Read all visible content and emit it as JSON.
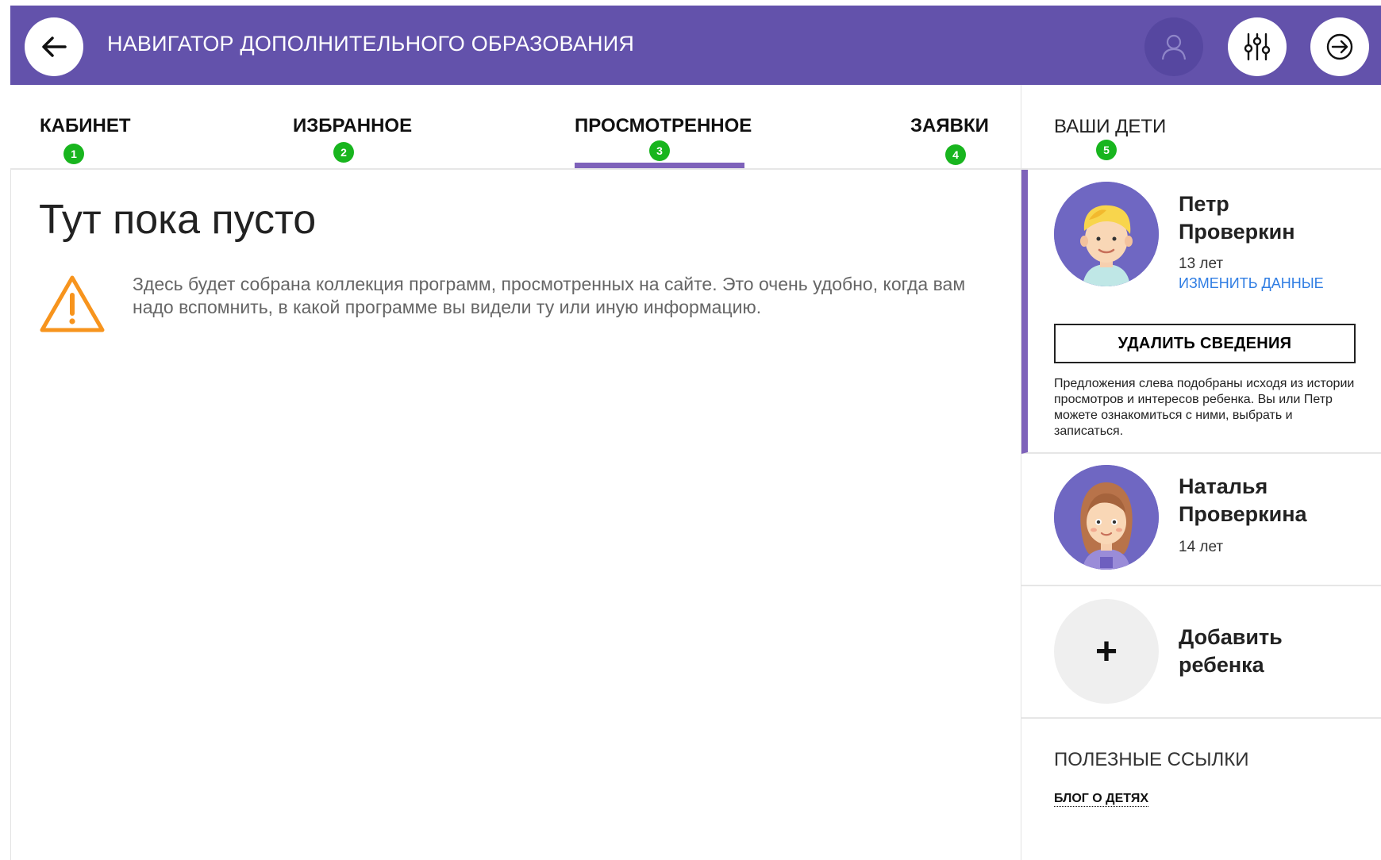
{
  "header": {
    "title": "НАВИГАТОР ДОПОЛНИТЕЛЬНОГО ОБРАЗОВАНИЯ",
    "bg_color": "#6352ab",
    "icons": {
      "back": "arrow-left-icon",
      "user": "user-icon",
      "filters": "sliders-icon",
      "logout": "logout-icon"
    }
  },
  "tabs": [
    {
      "label": "КАБИНЕТ",
      "badge": "1"
    },
    {
      "label": "ИЗБРАННОЕ",
      "badge": "2"
    },
    {
      "label": "ПРОСМОТРЕННОЕ",
      "badge": "3",
      "active": true
    },
    {
      "label": "ЗАЯВКИ",
      "badge": "4"
    }
  ],
  "main": {
    "title": "Тут пока пусто",
    "message": "Здесь будет собрана коллекция программ, просмотренных на сайте. Это очень удобно, когда вам надо вспомнить, в какой программе вы видели ту или иную информацию."
  },
  "sidebar": {
    "title": "ВАШИ ДЕТИ",
    "badge": "5",
    "children": [
      {
        "name_first": "Петр",
        "name_last": "Проверкин",
        "age": "13 лет",
        "edit_label": "ИЗМЕНИТЬ ДАННЫЕ",
        "delete_label": "УДАЛИТЬ СВЕДЕНИЯ",
        "note": "Предложения слева подобраны исходя из истории просмотров и интересов ребенка. Вы или Петр можете ознакомиться с ними, выбрать и записаться."
      },
      {
        "name_first": "Наталья",
        "name_last": "Проверкина",
        "age": "14 лет"
      }
    ],
    "add_child": {
      "icon": "+",
      "label_line1": "Добавить",
      "label_line2": "ребенка"
    },
    "links_title": "ПОЛЕЗНЫЕ ССЫЛКИ",
    "links": [
      {
        "label": "БЛОГ О ДЕТЯХ"
      }
    ]
  },
  "colors": {
    "accent": "#7e62ba",
    "badge": "#18b51e",
    "link": "#2f7de3",
    "warning": "#f7941d"
  }
}
